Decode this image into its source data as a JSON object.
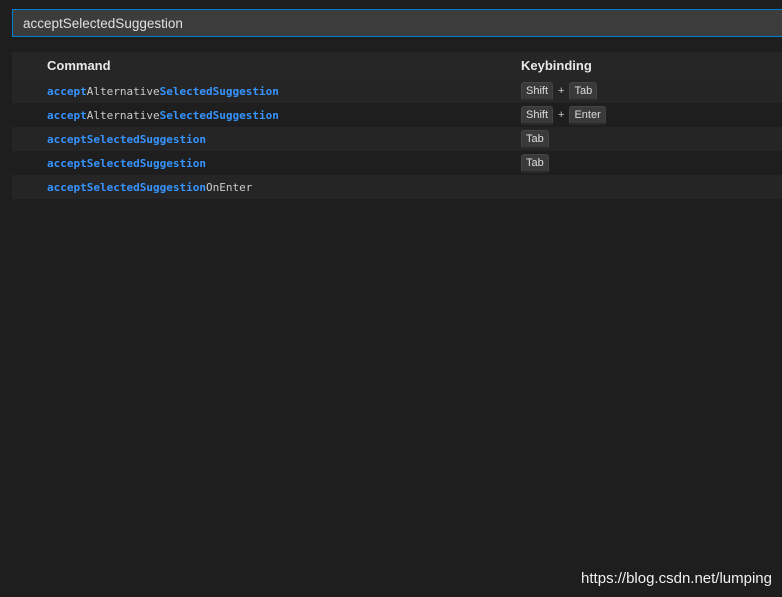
{
  "search": {
    "value": "acceptSelectedSuggestion"
  },
  "table": {
    "headers": {
      "command": "Command",
      "keybinding": "Keybinding"
    },
    "rows": [
      {
        "segments": [
          {
            "text": "accept",
            "hl": true
          },
          {
            "text": "Alternative",
            "hl": false
          },
          {
            "text": "SelectedSuggestion",
            "hl": true
          }
        ],
        "keys": [
          "Shift",
          "Tab"
        ]
      },
      {
        "segments": [
          {
            "text": "accept",
            "hl": true
          },
          {
            "text": "Alternative",
            "hl": false
          },
          {
            "text": "SelectedSuggestion",
            "hl": true
          }
        ],
        "keys": [
          "Shift",
          "Enter"
        ]
      },
      {
        "segments": [
          {
            "text": "acceptSelectedSuggestion",
            "hl": true
          }
        ],
        "keys": [
          "Tab"
        ]
      },
      {
        "segments": [
          {
            "text": "acceptSelectedSuggestion",
            "hl": true
          }
        ],
        "keys": [
          "Tab"
        ]
      },
      {
        "segments": [
          {
            "text": "acceptSelectedSuggestion",
            "hl": true
          },
          {
            "text": "OnEnter",
            "hl": false
          }
        ],
        "keys": []
      }
    ],
    "key_separator": "+"
  },
  "watermark": "https://blog.csdn.net/lumping",
  "colors": {
    "background": "#1e1e1e",
    "highlight": "#3794ff",
    "focus_border": "#007fd4"
  }
}
